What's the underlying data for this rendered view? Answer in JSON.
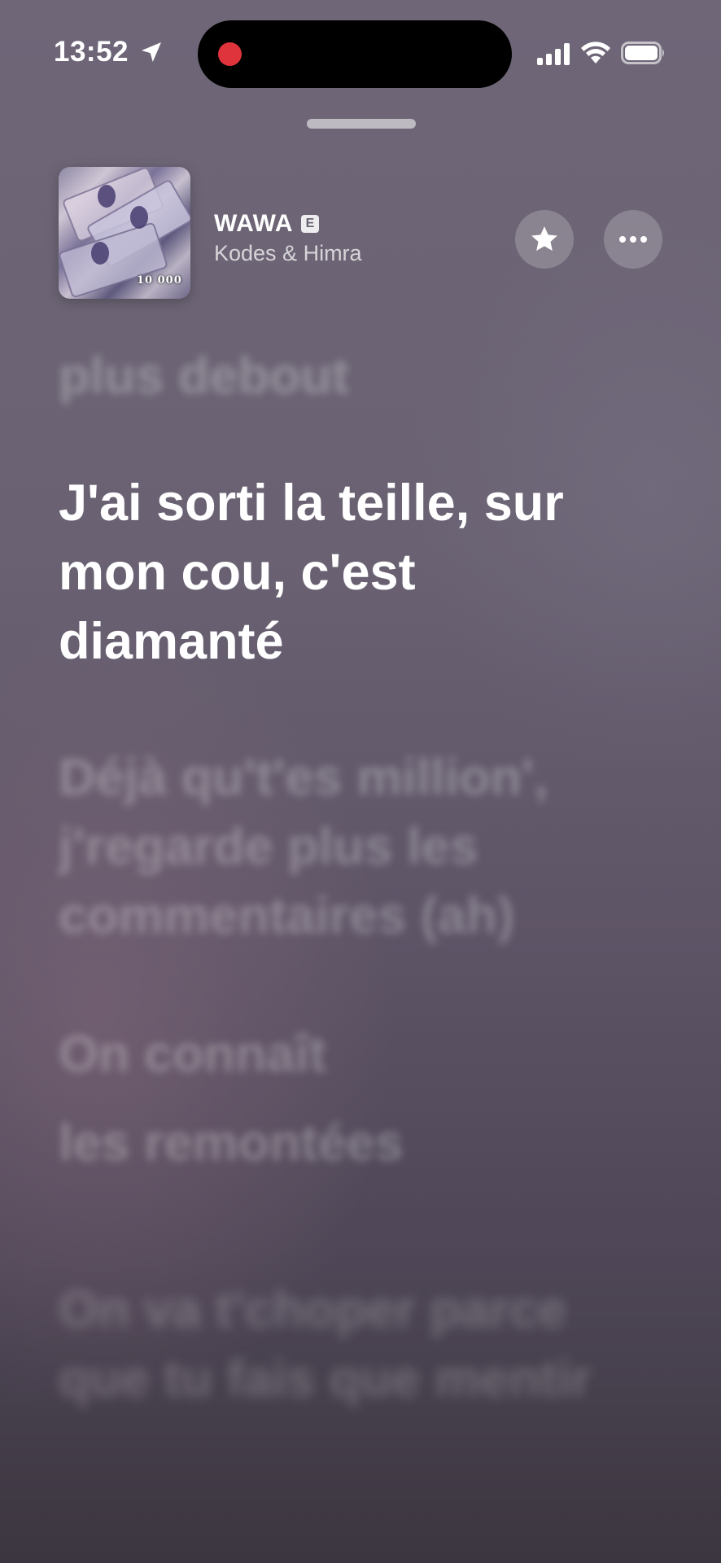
{
  "status_bar": {
    "time": "13:52",
    "location_icon": "location-arrow-icon",
    "recording_indicator_color": "#e0343c",
    "signal_icon": "cellular-signal-icon",
    "wifi_icon": "wifi-icon",
    "battery_icon": "battery-icon"
  },
  "now_playing": {
    "title": "WAWA",
    "explicit_badge": "E",
    "artist": "Kodes & Himra",
    "artwork_text": "10 000",
    "favorite_icon": "star-icon",
    "more_icon": "ellipsis-icon"
  },
  "lyrics": {
    "previous_tail": "plus debout",
    "current": "J'ai sorti la teille, sur mon cou, c'est diamanté",
    "next_1": "Déjà qu't'es million', j'regarde plus les commentaires (ah)",
    "next_2a": "On connaît",
    "next_2b": "les remontées",
    "next_3": "On va t'choper parce que tu fais que mentir"
  },
  "colors": {
    "active_lyric": "#ffffff",
    "background_top": "#6f6778",
    "background_bottom": "#3c3640"
  }
}
